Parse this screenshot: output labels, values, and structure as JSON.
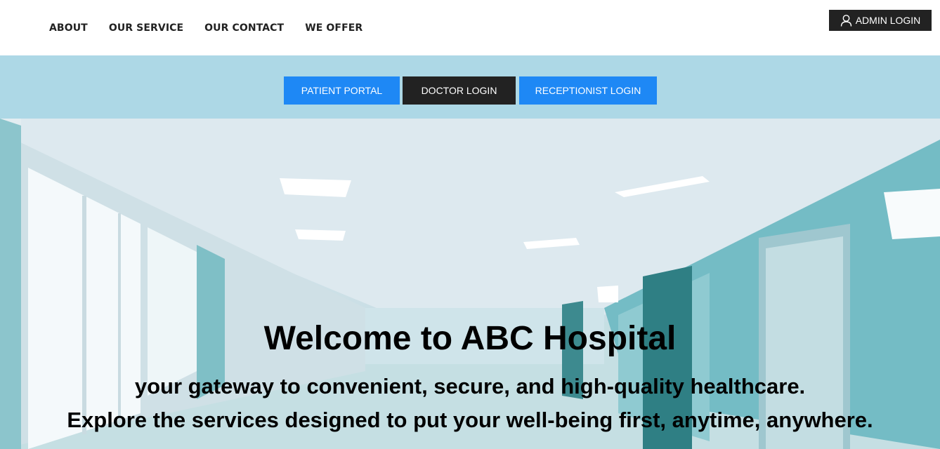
{
  "nav": {
    "items": [
      {
        "label": "ABOUT"
      },
      {
        "label": "OUR SERVICE"
      },
      {
        "label": "OUR CONTACT"
      },
      {
        "label": "WE OFFER"
      }
    ],
    "admin_login": "ADMIN LOGIN",
    "admin_icon": "user-icon"
  },
  "logins": {
    "patient": "PATIENT PORTAL",
    "doctor": "DOCTOR LOGIN",
    "receptionist": "RECEPTIONIST LOGIN"
  },
  "hero": {
    "title": "Welcome to ABC Hospital",
    "subtitle_line1": "your gateway to convenient, secure, and high-quality healthcare.",
    "subtitle_line2": "Explore the services designed to put your well-being first, anytime, anywhere."
  },
  "colors": {
    "band": "#add8e6",
    "primary_button": "#1e88f5",
    "dark_button": "#222222"
  }
}
